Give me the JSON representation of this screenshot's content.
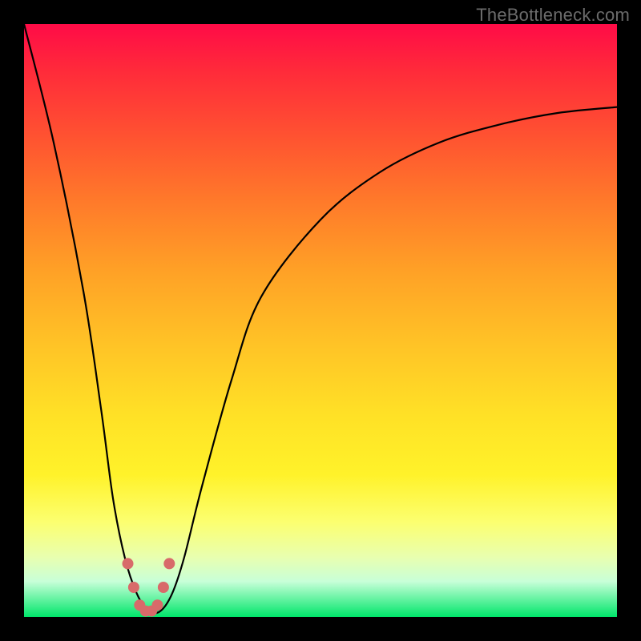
{
  "watermark": "TheBottleneck.com",
  "colors": {
    "frame_bg_top": "#ff0b47",
    "frame_bg_bottom": "#00e66a",
    "curve": "#000000",
    "dots": "#d86a6a",
    "page_bg": "#000000",
    "watermark": "#6b6b6b"
  },
  "chart_data": {
    "type": "line",
    "title": "",
    "xlabel": "",
    "ylabel": "",
    "xlim": [
      0,
      100
    ],
    "ylim": [
      0,
      100
    ],
    "series": [
      {
        "name": "bottleneck-curve",
        "x": [
          0,
          5,
          10,
          13,
          15,
          17,
          19,
          21,
          23,
          25,
          27,
          30,
          35,
          40,
          50,
          60,
          70,
          80,
          90,
          100
        ],
        "values": [
          100,
          80,
          55,
          35,
          20,
          10,
          4,
          1,
          1,
          4,
          10,
          22,
          40,
          54,
          67,
          75,
          80,
          83,
          85,
          86
        ]
      }
    ],
    "markers": {
      "name": "highlight-dots",
      "x": [
        17.5,
        18.5,
        19.5,
        20.5,
        21.5,
        22.5,
        23.5,
        24.5
      ],
      "values": [
        9,
        5,
        2,
        1,
        1,
        2,
        5,
        9
      ]
    }
  }
}
